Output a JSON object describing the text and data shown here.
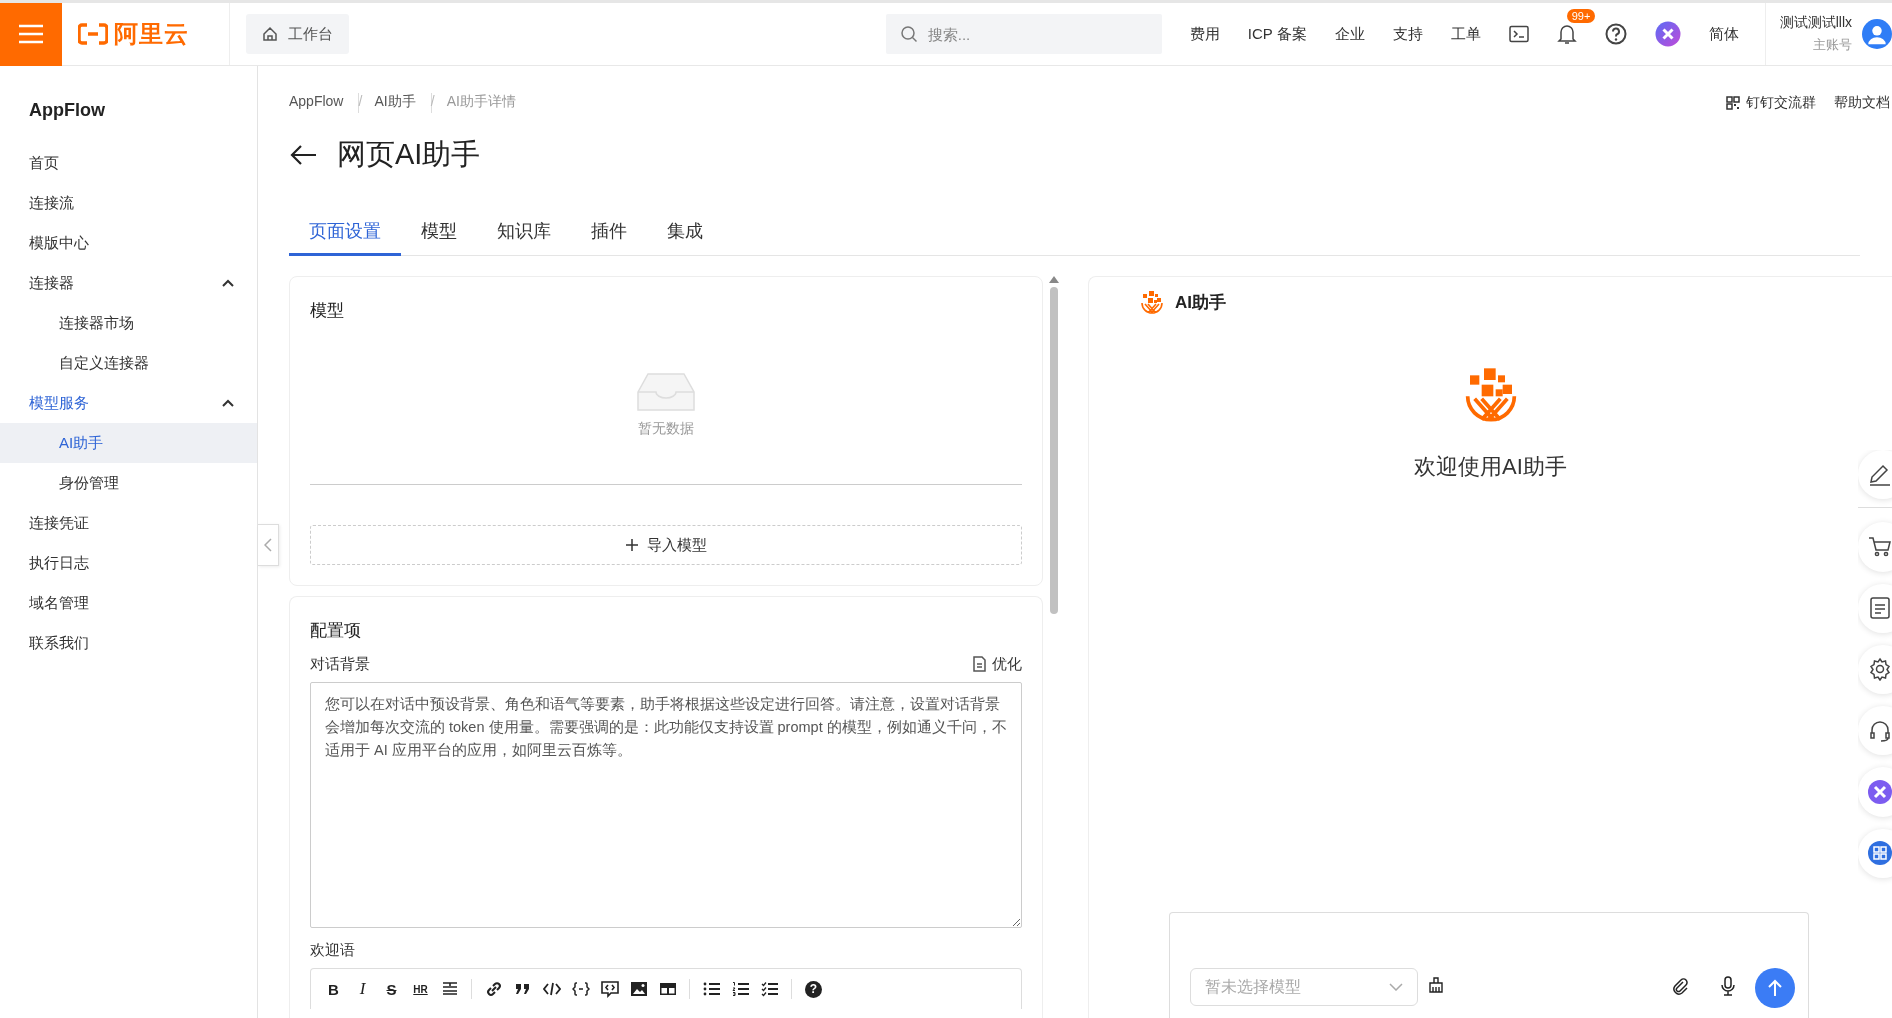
{
  "header": {
    "logo_text": "阿里云",
    "workbench": "工作台",
    "search": {
      "placeholder": "搜索..."
    },
    "nav": [
      "费用",
      "ICP 备案",
      "企业",
      "支持",
      "工单"
    ],
    "notification_badge": "99+",
    "language": "简体",
    "user": {
      "name": "测试测试lllx",
      "role": "主账号"
    }
  },
  "sidebar": {
    "title": "AppFlow",
    "items": [
      {
        "label": "首页",
        "selected": false
      },
      {
        "label": "连接流",
        "selected": false
      },
      {
        "label": "模版中心",
        "selected": false
      },
      {
        "label": "连接器",
        "selected": false,
        "expanded": true,
        "children": [
          {
            "label": "连接器市场",
            "selected": false
          },
          {
            "label": "自定义连接器",
            "selected": false
          }
        ]
      },
      {
        "label": "模型服务",
        "selected": false,
        "expanded": true,
        "children": [
          {
            "label": "AI助手",
            "selected": true
          },
          {
            "label": "身份管理",
            "selected": false
          }
        ]
      },
      {
        "label": "连接凭证",
        "selected": false
      },
      {
        "label": "执行日志",
        "selected": false
      },
      {
        "label": "域名管理",
        "selected": false
      },
      {
        "label": "联系我们",
        "selected": false
      }
    ]
  },
  "breadcrumb": {
    "items": [
      "AppFlow",
      "AI助手",
      "AI助手详情"
    ],
    "separators": [
      "/",
      "/"
    ]
  },
  "header_links": [
    "钉钉交流群",
    "帮助文档"
  ],
  "page_title": "网页AI助手",
  "tabs": [
    {
      "label": "页面设置",
      "selected": true
    },
    {
      "label": "模型",
      "selected": false
    },
    {
      "label": "知识库",
      "selected": false
    },
    {
      "label": "插件",
      "selected": false
    },
    {
      "label": "集成",
      "selected": false
    }
  ],
  "model_card": {
    "title": "模型",
    "empty_text": "暂无数据",
    "import_button": "导入模型"
  },
  "config_card": {
    "title": "配置项",
    "background_label": "对话背景",
    "optimize_button": "优化",
    "background_placeholder": "您可以在对话中预设背景、角色和语气等要素，助手将根据这些设定进行回答。请注意，设置对话背景会增加每次交流的 token 使用量。需要强调的是：此功能仅支持设置 prompt 的模型，例如通义千问，不适用于 AI 应用平台的应用，如阿里云百炼等。",
    "welcome_label": "欢迎语",
    "toolbar": [
      {
        "kind": "bold",
        "label": "B"
      },
      {
        "kind": "italic",
        "label": "I"
      },
      {
        "kind": "strike",
        "label": "S"
      },
      {
        "kind": "hr",
        "label": "HR"
      },
      {
        "kind": "heading"
      },
      {
        "kind": "separator"
      },
      {
        "kind": "link"
      },
      {
        "kind": "quote"
      },
      {
        "kind": "code"
      },
      {
        "kind": "code-block"
      },
      {
        "kind": "comment"
      },
      {
        "kind": "image"
      },
      {
        "kind": "table"
      },
      {
        "kind": "separator"
      },
      {
        "kind": "bullet-list"
      },
      {
        "kind": "ordered-list"
      },
      {
        "kind": "task-list"
      },
      {
        "kind": "separator"
      },
      {
        "kind": "help",
        "label": "?"
      }
    ]
  },
  "chat": {
    "title": "AI助手",
    "welcome": "欢迎使用AI助手",
    "model_select": {
      "placeholder": "暂未选择模型"
    }
  }
}
